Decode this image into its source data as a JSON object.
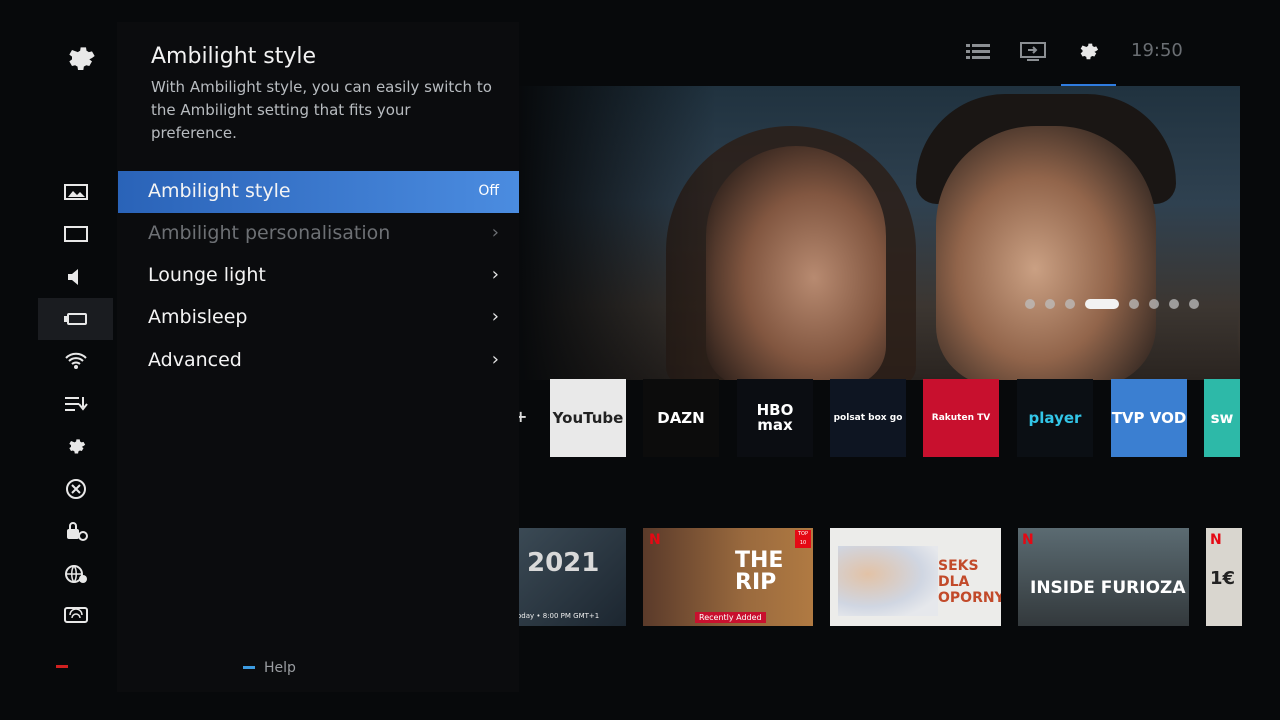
{
  "clock": "19:50",
  "panel": {
    "title": "Ambilight style",
    "description": "With Ambilight style, you can easily switch to the Ambilight setting that fits your preference.",
    "items": [
      {
        "label": "Ambilight style",
        "value": "Off",
        "selected": true,
        "disabled": false
      },
      {
        "label": "Ambilight personalisation",
        "disabled": true
      },
      {
        "label": "Lounge light",
        "disabled": false
      },
      {
        "label": "Ambisleep",
        "disabled": false
      },
      {
        "label": "Advanced",
        "disabled": false
      }
    ],
    "help": "Help"
  },
  "apps": [
    {
      "name": "YouTube",
      "bg": "#e9e9e9",
      "fg": "#222222"
    },
    {
      "name": "DAZN",
      "bg": "#0c0c0c",
      "fg": "#ffffff"
    },
    {
      "name": "HBO max",
      "bg": "#0b0d12",
      "fg": "#ffffff"
    },
    {
      "name": "polsat box go",
      "bg": "#0e1522",
      "fg": "#ffffff"
    },
    {
      "name": "Rakuten TV",
      "bg": "#c8102e",
      "fg": "#ffffff"
    },
    {
      "name": "player",
      "bg": "#0b0f14",
      "fg": "#33c6e8"
    },
    {
      "name": "TVP VOD",
      "bg": "#3b7fd1",
      "fg": "#ffffff"
    },
    {
      "name": "sw",
      "bg": "#2db9a8",
      "fg": "#ffffff"
    }
  ],
  "tiles": [
    {
      "caption": "oday • 8:00 PM GMT+1"
    },
    {
      "title": "THE RIP",
      "badge": "Recently Added",
      "corner": "TOP 10"
    },
    {
      "title": "SEKS DLA OPORNYCH"
    },
    {
      "title": "INSIDE FURIOZA"
    },
    {
      "title": "1€"
    }
  ],
  "hero": {
    "dots": 8,
    "active_dot": 3
  }
}
